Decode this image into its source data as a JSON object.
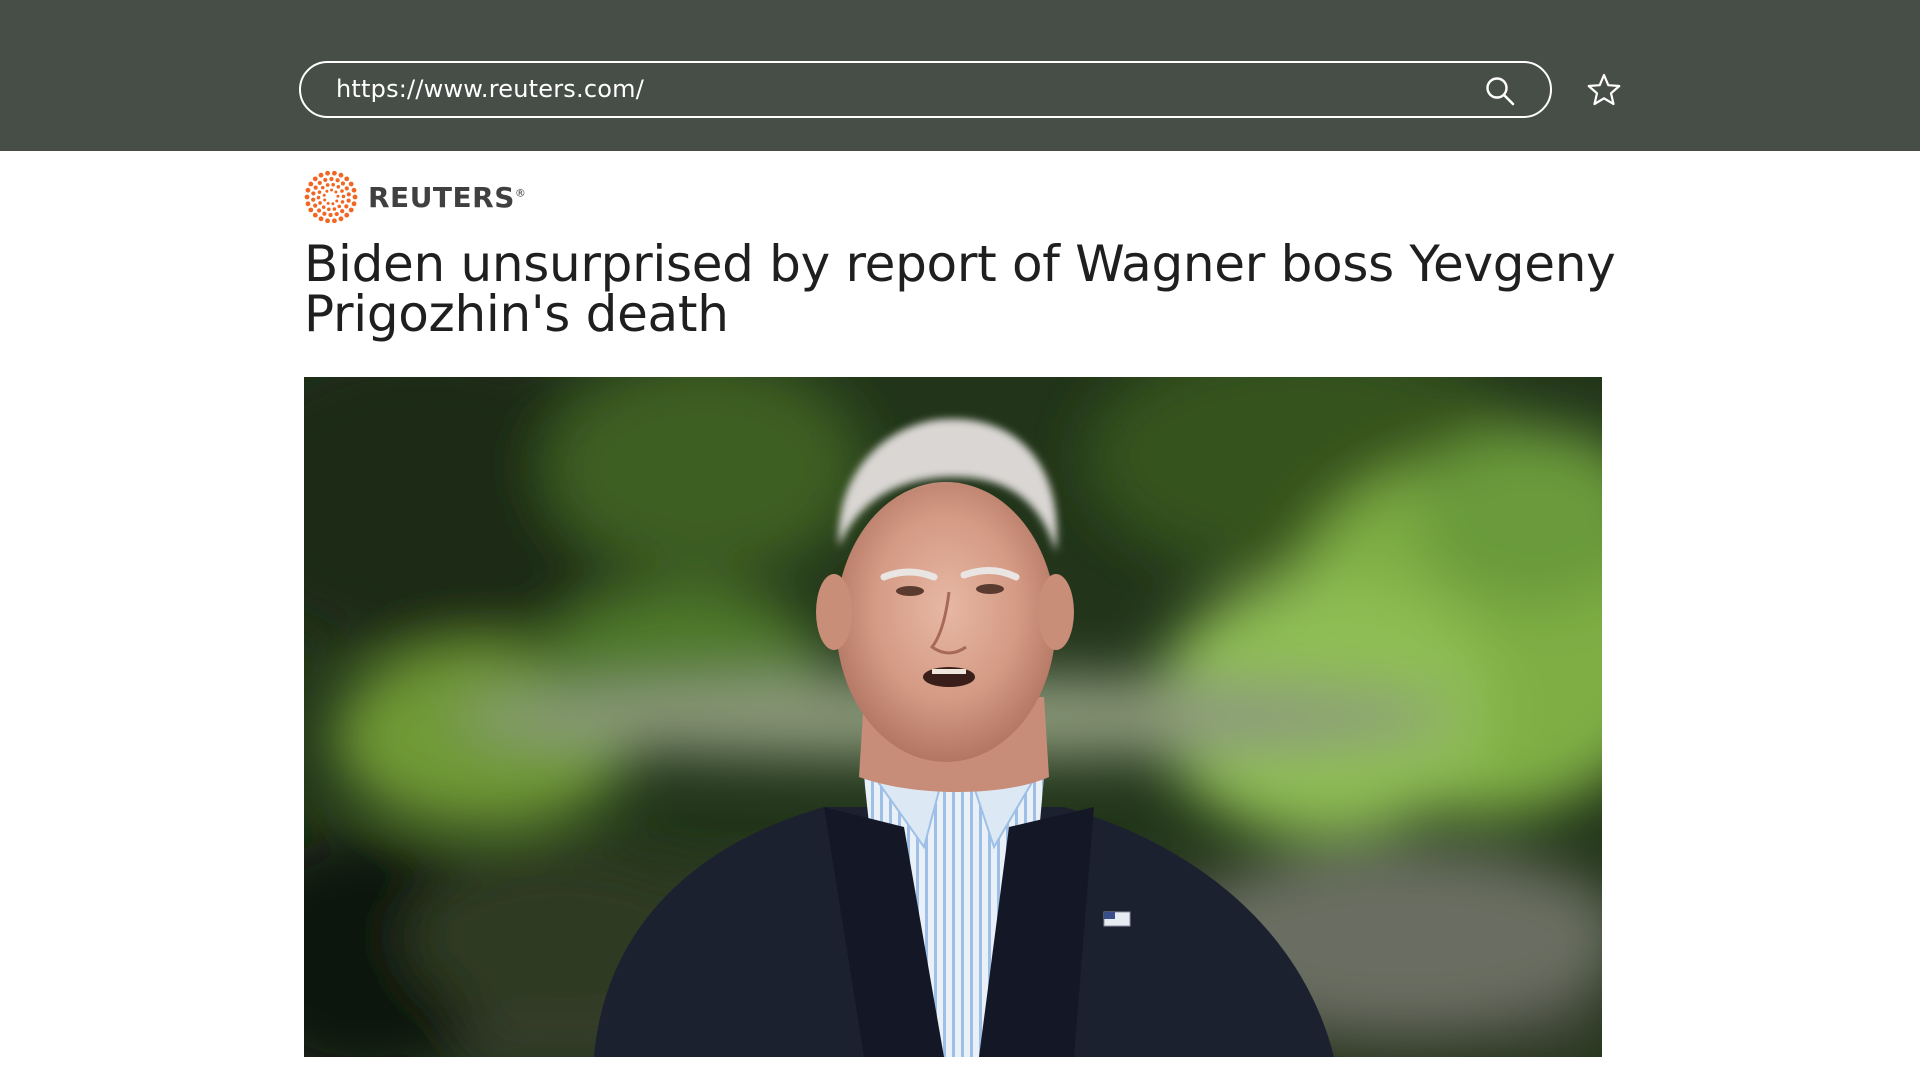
{
  "browser": {
    "url": "https://www.reuters.com/",
    "search_icon": "search-icon",
    "bookmark_icon": "star-icon"
  },
  "site": {
    "name": "REUTERS",
    "registered_mark": "®",
    "logo_icon": "reuters-logo-icon",
    "accent_color": "#f26522"
  },
  "article": {
    "headline": "Biden unsurprised by report of Wagner boss Yevgeny Prigozhin's death"
  },
  "colors": {
    "toolbar_bg": "#474e48",
    "page_bg": "#ffffff",
    "headline": "#1f1f1f"
  }
}
